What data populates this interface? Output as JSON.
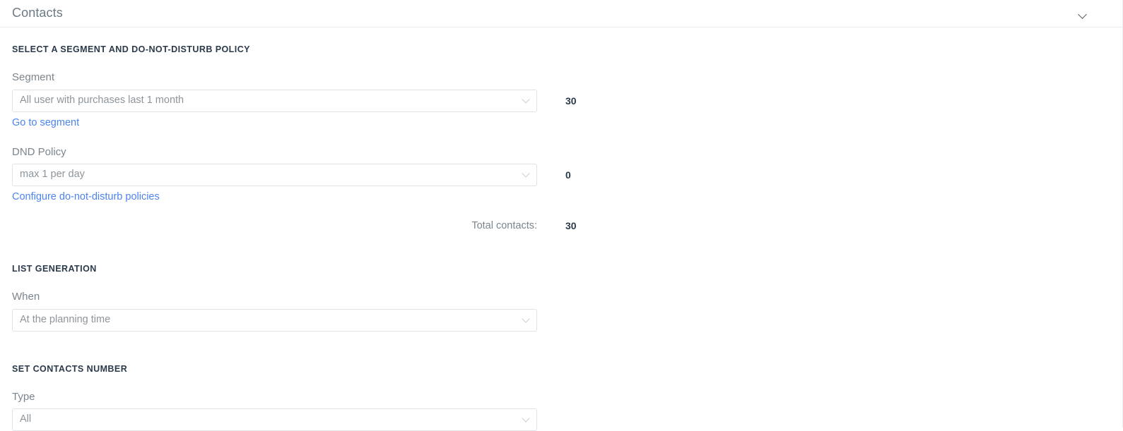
{
  "panel": {
    "title": "Contacts",
    "collapse_icon": "chevron-down-icon"
  },
  "sections": {
    "segment_policy": {
      "heading": "SELECT A SEGMENT AND DO-NOT-DISTURB POLICY",
      "segment": {
        "label": "Segment",
        "value": "All user with purchases last 1 month",
        "caret_icon": "chevron-down-icon",
        "count": "30",
        "link": "Go to segment"
      },
      "dnd": {
        "label": "DND Policy",
        "value": "max 1 per day",
        "caret_icon": "chevron-down-icon",
        "count": "0",
        "link": "Configure do-not-disturb policies"
      },
      "total": {
        "label": "Total contacts:",
        "value": "30"
      }
    },
    "list_generation": {
      "heading": "LIST GENERATION",
      "when": {
        "label": "When",
        "value": "At the planning time",
        "caret_icon": "chevron-down-icon"
      }
    },
    "set_contacts_number": {
      "heading": "SET CONTACTS NUMBER",
      "type": {
        "label": "Type",
        "value": "All",
        "caret_icon": "chevron-down-icon"
      }
    }
  },
  "colors": {
    "link": "#4c84f0",
    "heading": "#2b3a4a",
    "label": "#7b858d",
    "border": "#dfe3e6",
    "title": "#6e7b84"
  }
}
